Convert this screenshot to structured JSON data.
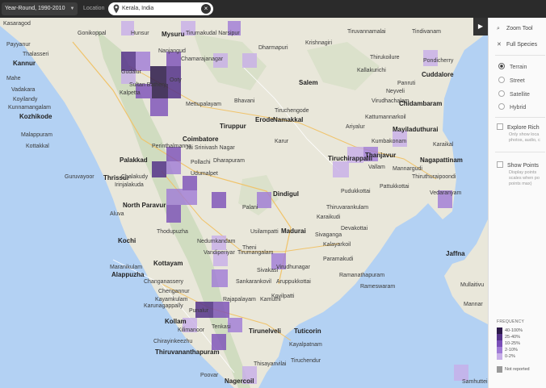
{
  "toolbar": {
    "date_range": "Year-Round, 1990-2010",
    "location_label": "Location",
    "location_value": "Kerala, India"
  },
  "sidebar": {
    "tools": [
      {
        "label": "Zoom Tool",
        "icon": "zoom-tool-icon"
      },
      {
        "label": "Full Species",
        "icon": "full-species-icon"
      }
    ],
    "map_types": [
      "Terrain",
      "Street",
      "Satellite",
      "Hybrid"
    ],
    "selected_map_type": "Terrain",
    "explore_rich": {
      "label": "Explore Rich",
      "desc": "Only show loca photos, audio, c"
    },
    "show_points": {
      "label": "Show Points",
      "desc": "Display points scales when po points max)"
    }
  },
  "legend": {
    "title": "FREQUENCY",
    "items": [
      {
        "label": "40-100%",
        "color": "#2d1a4a"
      },
      {
        "label": "25-40%",
        "color": "#55338a"
      },
      {
        "label": "10-25%",
        "color": "#7a4fb8"
      },
      {
        "label": "2-10%",
        "color": "#9f7ad6"
      },
      {
        "label": "0-2%",
        "color": "#c7aee9"
      }
    ],
    "not_reported": "Not reported"
  },
  "map_labels": [
    {
      "t": "Kasaragod",
      "big": false
    },
    {
      "t": "Gonikoppal",
      "big": false
    },
    {
      "t": "Hunsur",
      "big": false
    },
    {
      "t": "Mysuru",
      "big": true
    },
    {
      "t": "Tirumakudal Narsipur",
      "big": false
    },
    {
      "t": "Tiruvannamalai",
      "big": false
    },
    {
      "t": "Tindivanam",
      "big": false
    },
    {
      "t": "Payyanur",
      "big": false
    },
    {
      "t": "Thalasseri",
      "big": false
    },
    {
      "t": "Kannur",
      "big": true
    },
    {
      "t": "Mahe",
      "big": false
    },
    {
      "t": "Vadakara",
      "big": false
    },
    {
      "t": "Koyilandy",
      "big": false
    },
    {
      "t": "Kozhikode",
      "big": true
    },
    {
      "t": "Kunnamangalam",
      "big": false
    },
    {
      "t": "Malappuram",
      "big": false
    },
    {
      "t": "Kottakkal",
      "big": false
    },
    {
      "t": "Guruvayoor",
      "big": false
    },
    {
      "t": "Thrissur",
      "big": true
    },
    {
      "t": "Nanjangud",
      "big": false
    },
    {
      "t": "Chamarajanagar",
      "big": false
    },
    {
      "t": "Dharmapuri",
      "big": false
    },
    {
      "t": "Krishnagiri",
      "big": false
    },
    {
      "t": "Pondicherry",
      "big": false
    },
    {
      "t": "Cuddalore",
      "big": true
    },
    {
      "t": "Thirukoilure",
      "big": false
    },
    {
      "t": "Kallakurichi",
      "big": false
    },
    {
      "t": "Salem",
      "big": true
    },
    {
      "t": "Panruti",
      "big": false
    },
    {
      "t": "Neyveli",
      "big": false
    },
    {
      "t": "Virudhachalam",
      "big": false
    },
    {
      "t": "Chidambaram",
      "big": true
    },
    {
      "t": "Mettupalayam",
      "big": false
    },
    {
      "t": "Gudalur",
      "big": false
    },
    {
      "t": "Sultan Bathery",
      "big": false
    },
    {
      "t": "Kalpetta",
      "big": false
    },
    {
      "t": "Ooty",
      "big": false
    },
    {
      "t": "Bhavani",
      "big": false
    },
    {
      "t": "Tiruchengode",
      "big": false
    },
    {
      "t": "Namakkal",
      "big": true
    },
    {
      "t": "Erode",
      "big": true
    },
    {
      "t": "Tiruppur",
      "big": true
    },
    {
      "t": "Coimbatore",
      "big": true
    },
    {
      "t": "Palakkad",
      "big": true
    },
    {
      "t": "Perinthalmanna",
      "big": false
    },
    {
      "t": "Jai Srinivash Nagar",
      "big": false
    },
    {
      "t": "Pollachi",
      "big": false
    },
    {
      "t": "Udumalpet",
      "big": false
    },
    {
      "t": "Karur",
      "big": false
    },
    {
      "t": "Tiruchirappalli",
      "big": true
    },
    {
      "t": "Ariyalur",
      "big": false
    },
    {
      "t": "Kattumannarkoil",
      "big": false
    },
    {
      "t": "Mayiladuthurai",
      "big": true
    },
    {
      "t": "Kumbakonam",
      "big": false
    },
    {
      "t": "Thanjavur",
      "big": true
    },
    {
      "t": "Karaikal",
      "big": false
    },
    {
      "t": "Vallam",
      "big": false
    },
    {
      "t": "Mannargudi",
      "big": false
    },
    {
      "t": "Nagapattinam",
      "big": true
    },
    {
      "t": "Pattukkottai",
      "big": false
    },
    {
      "t": "Thiruthuraipoondi",
      "big": false
    },
    {
      "t": "Vedaranyam",
      "big": false
    },
    {
      "t": "Pudukkottai",
      "big": false
    },
    {
      "t": "Dharapuram",
      "big": false
    },
    {
      "t": "Dindigul",
      "big": true
    },
    {
      "t": "Palani",
      "big": false
    },
    {
      "t": "Thiruvarankulam",
      "big": false
    },
    {
      "t": "Karaikudi",
      "big": false
    },
    {
      "t": "Devakottai",
      "big": false
    },
    {
      "t": "Madurai",
      "big": true
    },
    {
      "t": "Sivaganga",
      "big": false
    },
    {
      "t": "Kalayarkoil",
      "big": false
    },
    {
      "t": "Paramakudi",
      "big": false
    },
    {
      "t": "Ramanathapuram",
      "big": false
    },
    {
      "t": "Rameswaram",
      "big": false
    },
    {
      "t": "Irinjalakuda",
      "big": false
    },
    {
      "t": "Chalakudy",
      "big": false
    },
    {
      "t": "North Paravur",
      "big": true
    },
    {
      "t": "Aluva",
      "big": false
    },
    {
      "t": "Kochi",
      "big": true
    },
    {
      "t": "Thodupuzha",
      "big": false
    },
    {
      "t": "Nedumkandam",
      "big": false
    },
    {
      "t": "Vandiperiyar",
      "big": false
    },
    {
      "t": "Theni",
      "big": false
    },
    {
      "t": "Usilampatti",
      "big": false
    },
    {
      "t": "Tirumangalam",
      "big": false
    },
    {
      "t": "Virudhunagar",
      "big": false
    },
    {
      "t": "Sivakasi",
      "big": false
    },
    {
      "t": "Aruppukkottai",
      "big": false
    },
    {
      "t": "Kamuthi",
      "big": false
    },
    {
      "t": "Maranikulam",
      "big": false
    },
    {
      "t": "Kottayam",
      "big": true
    },
    {
      "t": "Alappuzha",
      "big": true
    },
    {
      "t": "Changanassery",
      "big": false
    },
    {
      "t": "Chengannur",
      "big": false
    },
    {
      "t": "Kayamkulam",
      "big": false
    },
    {
      "t": "Karunagappally",
      "big": false
    },
    {
      "t": "Punalur",
      "big": false
    },
    {
      "t": "Rajapalayam",
      "big": false
    },
    {
      "t": "Sankarankovil",
      "big": false
    },
    {
      "t": "Kovilpatti",
      "big": false
    },
    {
      "t": "Kollam",
      "big": true
    },
    {
      "t": "Kilimanoor",
      "big": false
    },
    {
      "t": "Tenkasi",
      "big": false
    },
    {
      "t": "Tirunelveli",
      "big": true
    },
    {
      "t": "Tuticorin",
      "big": true
    },
    {
      "t": "Chirayinkeezhu",
      "big": false
    },
    {
      "t": "Thiruvananthapuram",
      "big": true
    },
    {
      "t": "Kayalpatnam",
      "big": false
    },
    {
      "t": "Tiruchendur",
      "big": false
    },
    {
      "t": "Poovar",
      "big": false
    },
    {
      "t": "Nagercoil",
      "big": true
    },
    {
      "t": "Thisayanvilai",
      "big": false
    },
    {
      "t": "Jaffna",
      "big": true
    },
    {
      "t": "Mullaitivu",
      "big": false
    },
    {
      "t": "Mannar",
      "big": false
    },
    {
      "t": "Samhuttei",
      "big": false
    }
  ]
}
